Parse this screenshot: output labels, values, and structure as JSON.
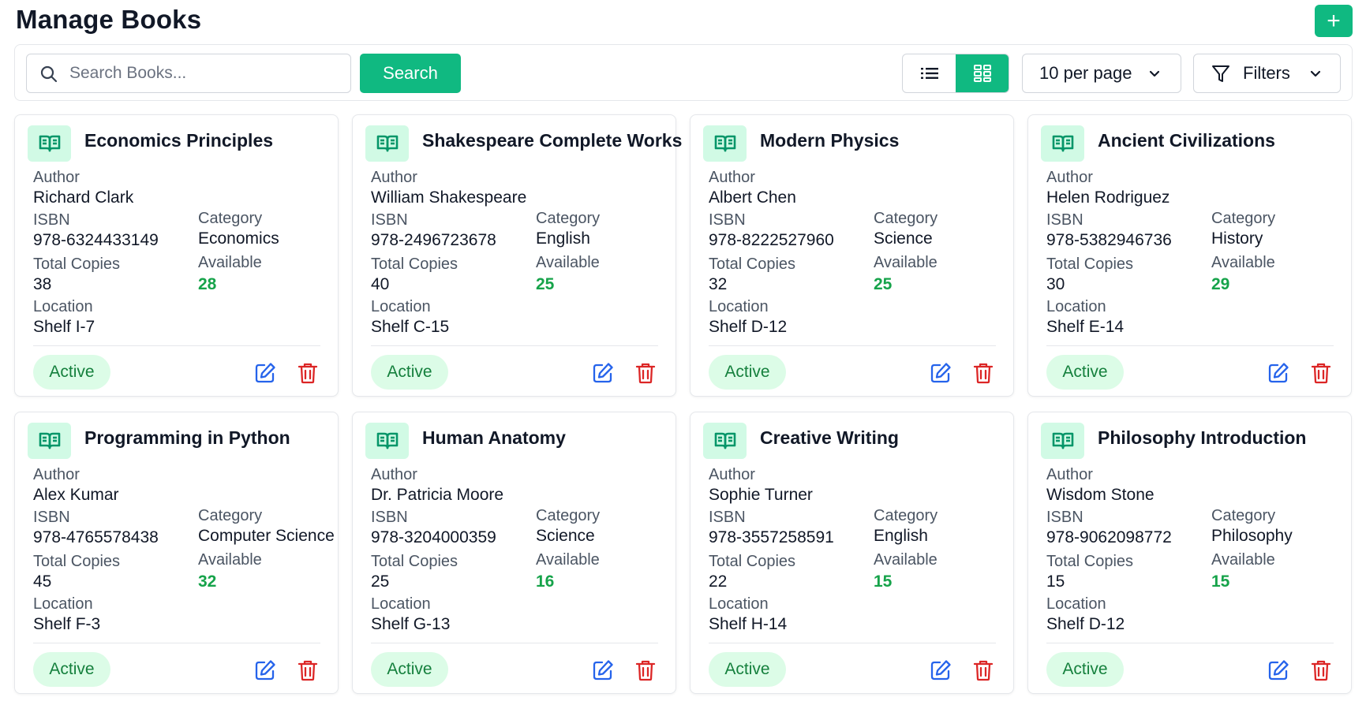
{
  "page": {
    "title": "Manage Books"
  },
  "toolbar": {
    "add_label": "+",
    "search_placeholder": "Search Books...",
    "search_value": "",
    "search_button": "Search",
    "view_modes": [
      "list",
      "grid"
    ],
    "active_view": "grid",
    "per_page": "10 per page",
    "filters": "Filters"
  },
  "labels": {
    "author": "Author",
    "isbn": "ISBN",
    "category": "Category",
    "total_copies": "Total Copies",
    "available": "Available",
    "location": "Location"
  },
  "colors": {
    "accent": "#10b981",
    "available_text": "#16a34a",
    "status_bg": "#dcfce7",
    "edit_icon": "#2563eb",
    "delete_icon": "#dc2626"
  },
  "books": [
    {
      "title": "Economics Principles",
      "author": "Richard Clark",
      "isbn": "978-6324433149",
      "category": "Economics",
      "total": "38",
      "available": "28",
      "location": "Shelf I-7",
      "status": "Active"
    },
    {
      "title": "Shakespeare Complete Works",
      "author": "William Shakespeare",
      "isbn": "978-2496723678",
      "category": "English",
      "total": "40",
      "available": "25",
      "location": "Shelf C-15",
      "status": "Active"
    },
    {
      "title": "Modern Physics",
      "author": "Albert Chen",
      "isbn": "978-8222527960",
      "category": "Science",
      "total": "32",
      "available": "25",
      "location": "Shelf D-12",
      "status": "Active"
    },
    {
      "title": "Ancient Civilizations",
      "author": "Helen Rodriguez",
      "isbn": "978-5382946736",
      "category": "History",
      "total": "30",
      "available": "29",
      "location": "Shelf E-14",
      "status": "Active"
    },
    {
      "title": "Programming in Python",
      "author": "Alex Kumar",
      "isbn": "978-4765578438",
      "category": "Computer Science",
      "total": "45",
      "available": "32",
      "location": "Shelf F-3",
      "status": "Active"
    },
    {
      "title": "Human Anatomy",
      "author": "Dr. Patricia Moore",
      "isbn": "978-3204000359",
      "category": "Science",
      "total": "25",
      "available": "16",
      "location": "Shelf G-13",
      "status": "Active"
    },
    {
      "title": "Creative Writing",
      "author": "Sophie Turner",
      "isbn": "978-3557258591",
      "category": "English",
      "total": "22",
      "available": "15",
      "location": "Shelf H-14",
      "status": "Active"
    },
    {
      "title": "Philosophy Introduction",
      "author": "Wisdom Stone",
      "isbn": "978-9062098772",
      "category": "Philosophy",
      "total": "15",
      "available": "15",
      "location": "Shelf D-12",
      "status": "Active"
    }
  ]
}
